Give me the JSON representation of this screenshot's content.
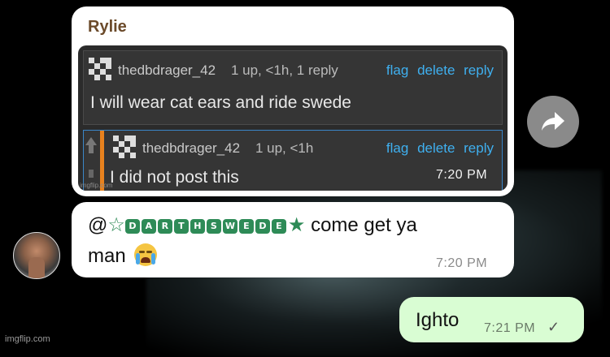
{
  "message1": {
    "sender": "Rylie",
    "time": "7:20 PM",
    "screenshot": {
      "comment1": {
        "user": "thedbdrager_42",
        "meta": "1 up, <1h, 1 reply",
        "links": [
          "flag",
          "delete",
          "reply"
        ],
        "text": "I will wear cat ears and ride swede"
      },
      "comment2": {
        "user": "thedbdrager_42",
        "meta": "1 up, <1h",
        "links": [
          "flag",
          "delete",
          "reply"
        ],
        "text": "I did not post this"
      },
      "watermark": "imgflip.com"
    }
  },
  "message2": {
    "prefix": "@",
    "name_letters": [
      "D",
      "A",
      "R",
      "T",
      "H",
      "S",
      "W",
      "E",
      "D",
      "E"
    ],
    "text_after": "come get ya",
    "line2": "man",
    "time": "7:20 PM"
  },
  "message3": {
    "text": "Ighto",
    "time": "7:21 PM",
    "status": "✓"
  },
  "footer": {
    "watermark": "imgflip.com"
  },
  "icons": {
    "share": "share-arrow-icon",
    "emoji": "loudly-crying-face-icon",
    "read": "single-check-icon"
  },
  "colors": {
    "sender_name": "#6b4a2a",
    "link_blue": "#3fb0f0",
    "badge_green": "#2e8b57",
    "outgoing_bubble": "#d9fdd3"
  }
}
